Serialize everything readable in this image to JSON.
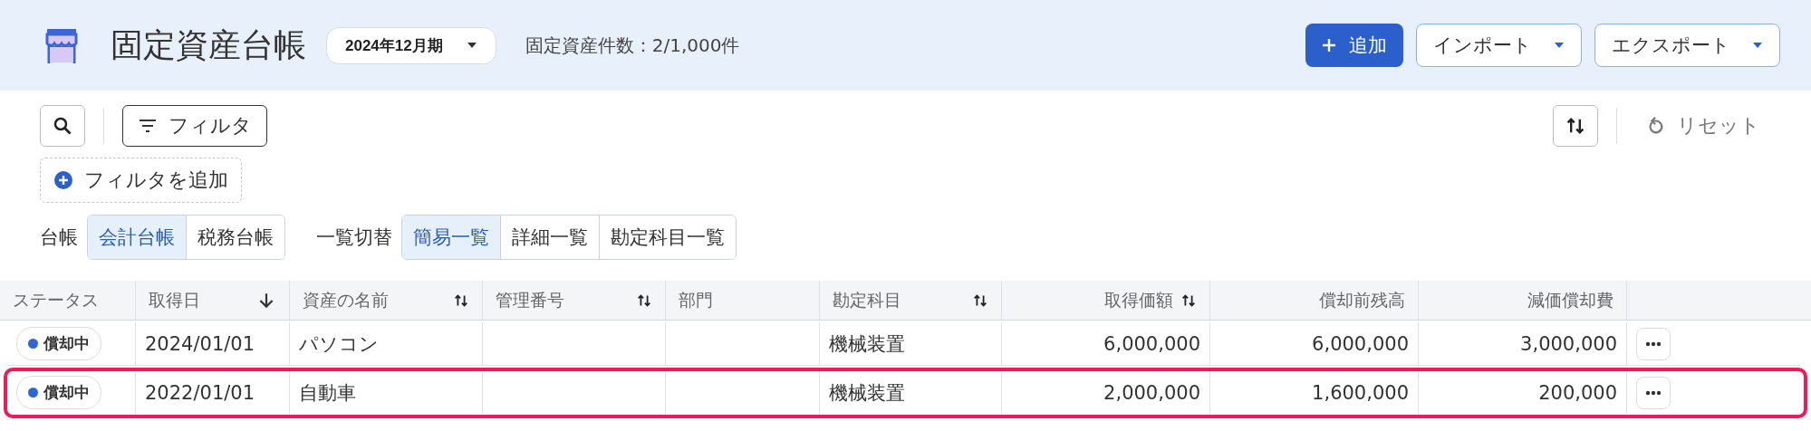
{
  "header": {
    "title": "固定資産台帳",
    "period": "2024年12月期",
    "count": "固定資産件数：2/1,000件",
    "buttons": [
      {
        "label": "追加",
        "kind": "primary"
      },
      {
        "label": "インポート",
        "kind": "dropdown"
      },
      {
        "label": "エクスポート",
        "kind": "dropdown"
      }
    ]
  },
  "toolbar": {
    "filter": "フィルタ",
    "reset": "リセット",
    "add_filter": "フィルタを追加"
  },
  "ledger": {
    "label": "台帳",
    "options": [
      {
        "label": "会計台帳",
        "selected": true
      },
      {
        "label": "税務台帳",
        "selected": false
      }
    ]
  },
  "view": {
    "label": "一覧切替",
    "options": [
      {
        "label": "簡易一覧",
        "selected": true
      },
      {
        "label": "詳細一覧",
        "selected": false
      },
      {
        "label": "勘定科目一覧",
        "selected": false
      }
    ]
  },
  "table": {
    "columns": [
      {
        "label": "ステータス",
        "kind": "plain",
        "numeric": false
      },
      {
        "label": "取得日",
        "kind": "sorted",
        "numeric": false
      },
      {
        "label": "資産の名前",
        "kind": "sortable",
        "numeric": false
      },
      {
        "label": "管理番号",
        "kind": "sortable",
        "numeric": false
      },
      {
        "label": "部門",
        "kind": "plain",
        "numeric": false
      },
      {
        "label": "勘定科目",
        "kind": "sortable",
        "numeric": false
      },
      {
        "label": "取得価額",
        "kind": "sortable",
        "numeric": true
      },
      {
        "label": "償却前残高",
        "kind": "plain",
        "numeric": true
      },
      {
        "label": "減価償却費",
        "kind": "plain",
        "numeric": true
      }
    ],
    "rows": [
      {
        "color": "#2f66d6",
        "cells": [
          "償却中",
          "2024/01/01",
          "パソコン",
          "",
          "",
          "機械装置",
          "6,000,000",
          "6,000,000",
          "3,000,000"
        ],
        "highlighted": false
      },
      {
        "color": "#2f66d6",
        "cells": [
          "償却中",
          "2022/01/01",
          "自動車",
          "",
          "",
          "機械装置",
          "2,000,000",
          "1,600,000",
          "200,000"
        ],
        "highlighted": true
      }
    ]
  }
}
